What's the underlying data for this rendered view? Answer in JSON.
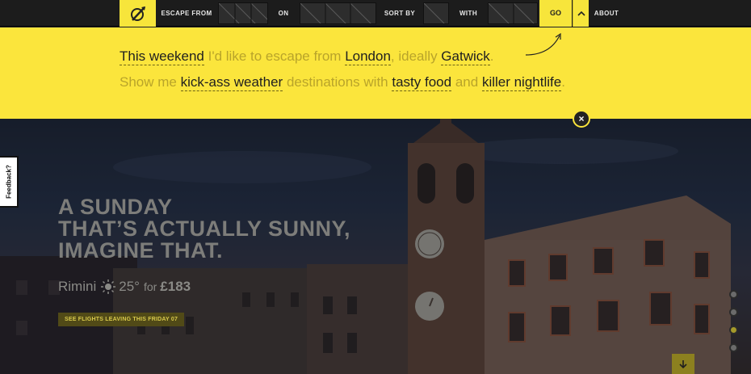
{
  "nav": {
    "escape_from": "ESCAPE FROM",
    "on": "ON",
    "sort_by": "SORT BY",
    "with": "WITH",
    "go": "GO",
    "about": "ABOUT",
    "logo_icon": "compass-pen-logo",
    "expand_icon": "chevron-up-icon"
  },
  "sentence": {
    "line1": {
      "when": "This weekend",
      "filler1": "I'd like to escape from",
      "from": "London",
      "filler2": ", ideally",
      "airport": "Gatwick",
      "end": "."
    },
    "line2": {
      "filler1": "Show me",
      "weather": "kick-ass weather",
      "filler2": "destinations with",
      "food": "tasty food",
      "filler3": "and",
      "nightlife": "killer nightlife",
      "end": "."
    },
    "close_label": "×"
  },
  "hero": {
    "headline": [
      "A SUNDAY",
      "THAT’S ACTUALLY SUNNY,",
      "IMAGINE THAT."
    ],
    "city": "Rimini",
    "temperature": "25°",
    "for_label": "for",
    "price": "£183",
    "weather_icon": "sun-icon",
    "flights_button": "SEE FLIGHTS LEAVING THIS FRIDAY 07",
    "feedback": "Feedback?",
    "slides_total": 4,
    "slide_active": 3,
    "down_icon": "arrow-down-icon"
  },
  "colors": {
    "accent": "#fbe53c",
    "nav_bg": "#1c1c1c",
    "choice_text": "#1f1f1f",
    "filler_text": "#b9a42a"
  }
}
